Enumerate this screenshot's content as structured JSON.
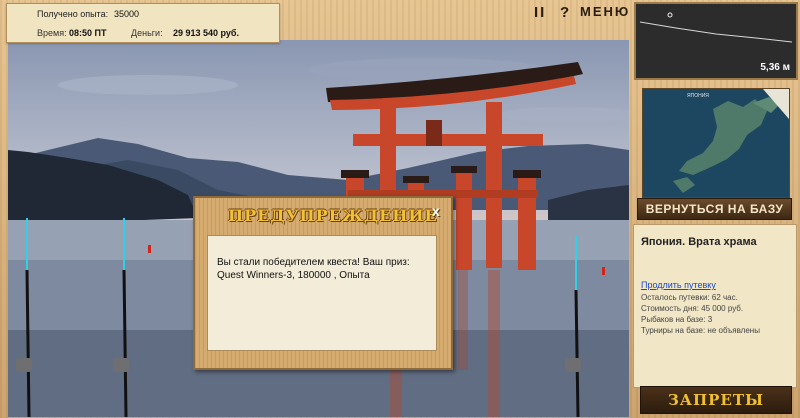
{
  "stats": {
    "exp_label": "Получено опыта:",
    "exp_value": "35000",
    "time_label": "Время:",
    "time_value": "08:50 ПТ",
    "money_label": "Деньги:",
    "money_value": "29 913 540 руб."
  },
  "top_buttons": {
    "pause": "II",
    "help": "?",
    "menu": "МЕНЮ"
  },
  "depth": {
    "value": "5,36 м"
  },
  "map": {
    "title": "ЯПОНИЯ"
  },
  "right_panel": {
    "return_button": "ВЕРНУТЬСЯ НА БАЗУ",
    "location": "Япония. Врата храма",
    "extend_link": "Продлить путевку",
    "remaining": "Осталось путевки: 62 час.",
    "day_cost": "Стоимость дня: 45 000 руб.",
    "fishers": "Рыбаков на базе: 3",
    "tournaments": "Турниры на базе: не объявлены",
    "bans_button": "ЗАПРЕТЫ"
  },
  "dialog": {
    "title": "ПРЕДУПРЕЖДЕНИЕ",
    "close": "x",
    "message": "Вы стали победителем квеста! Ваш приз: Quest Winners-3, 180000 , Опыта"
  },
  "rods": [
    {
      "id": 1,
      "tip": "#2fd0e8"
    },
    {
      "id": 2,
      "tip": "#2fd0e8"
    },
    {
      "id": 3,
      "tip": "#2fd0e8"
    }
  ],
  "colors": {
    "torii": "#c8462a",
    "dialog_title": "#f2c234",
    "link": "#1b49c8"
  }
}
